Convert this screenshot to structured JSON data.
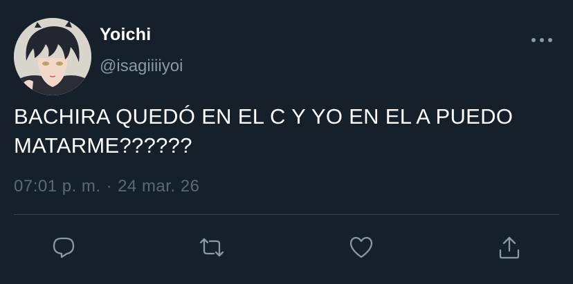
{
  "tweet": {
    "display_name": "Yoichi",
    "handle": "@isagiiiiyoi",
    "text": "BACHIRA QUEDÓ EN EL C Y YO EN EL A PUEDO MATARME??????",
    "time": "07:01 p. m.",
    "separator": "·",
    "date": "24 mar. 26"
  },
  "icons": {
    "more": "more-dots-icon",
    "reply": "reply-bubble-icon",
    "retweet": "retweet-icon",
    "like": "heart-icon",
    "share": "share-upload-icon"
  },
  "colors": {
    "background": "#15202b",
    "primary_text": "#ffffff",
    "secondary_text": "#8b98a5",
    "divider": "#38444d"
  }
}
